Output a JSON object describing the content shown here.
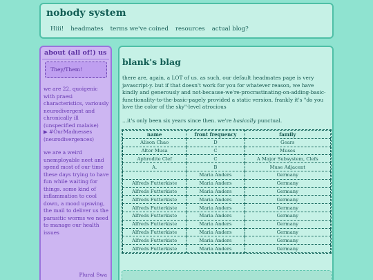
{
  "header": {
    "title": "nobody system",
    "nav": [
      "Hiii!",
      "headmates",
      "terms we've coined",
      "resources",
      "actual blog?"
    ]
  },
  "sidebar": {
    "title": "about (all of!) us",
    "pronouns": "They/Them!",
    "bio": "we are 22, quoigenic with praesi characteristics, variously neurodivergent and chronically ill (unspecified malaise)",
    "summary_marker": "▶",
    "summary": "#OurMadnesses (neurodivergences)",
    "about": "we are a weird unemployable neet and spend most of our time these days trying to have fun while waiting for things. some kind of inflammation to cool down, a mood upswing, the mail to deliver us the parasitic worms we need to manage our health issues",
    "signature": "Plural Swa"
  },
  "main": {
    "title": "blank's blag",
    "paragraph": "there are, again, a LOT of us. as such, our default headmates page is very javascript-y. but if that doesn't work for you for whatever reason, we have kindly and generously and not-because-we're-procrastinating-on-adding-basic-functionality-to-the-basic-pagely provided a static version. frankly it's \"do you love the color of the sky\"-level atrocious",
    "paragraph2_prefix": "...it's only been six years since then. we're ",
    "paragraph2_emph": "basically",
    "paragraph2_suffix": " punctual.",
    "table": {
      "headers": [
        "name",
        "front frequency",
        "family"
      ],
      "rows": [
        [
          "Alison Chao",
          "D",
          "Gears"
        ],
        [
          "Alter Musa",
          "C",
          "Muses"
        ],
        [
          "Aphrodite Clef",
          "C",
          "A Major Subsystem, Clefs"
        ],
        [
          "A.",
          "B",
          "Muse Adjacent"
        ],
        [
          "",
          "Maria Anders",
          "Germany"
        ],
        [
          "Alfreds Futterkiste",
          "Maria Anders",
          "Germany"
        ],
        [
          "Alfreds Futterkiste",
          "Maria Anders",
          "Germany"
        ],
        [
          "Alfreds Futterkiste",
          "Maria Anders",
          "Germany"
        ],
        [
          "Alfreds Futterkiste",
          "Maria Anders",
          "Germany"
        ],
        [
          "Alfreds Futterkiste",
          "Maria Anders",
          "Germany"
        ],
        [
          "Alfreds Futterkiste",
          "Maria Anders",
          "Germany"
        ],
        [
          "Alfreds Futterkiste",
          "Maria Anders",
          "Germany"
        ],
        [
          "Alfreds Futterkiste",
          "Maria Anders",
          "Germany"
        ],
        [
          "Alfreds Futterkiste",
          "Maria Anders",
          "Germany"
        ]
      ]
    }
  },
  "colors": {
    "page_bg": "#8fe3d0",
    "panel_bg": "#c6f1e6",
    "panel_border": "#4fbfa6",
    "sidebar_bg": "#cdb6f2",
    "sidebar_border": "#9a73dc",
    "sidebar_text": "#6637b0"
  }
}
